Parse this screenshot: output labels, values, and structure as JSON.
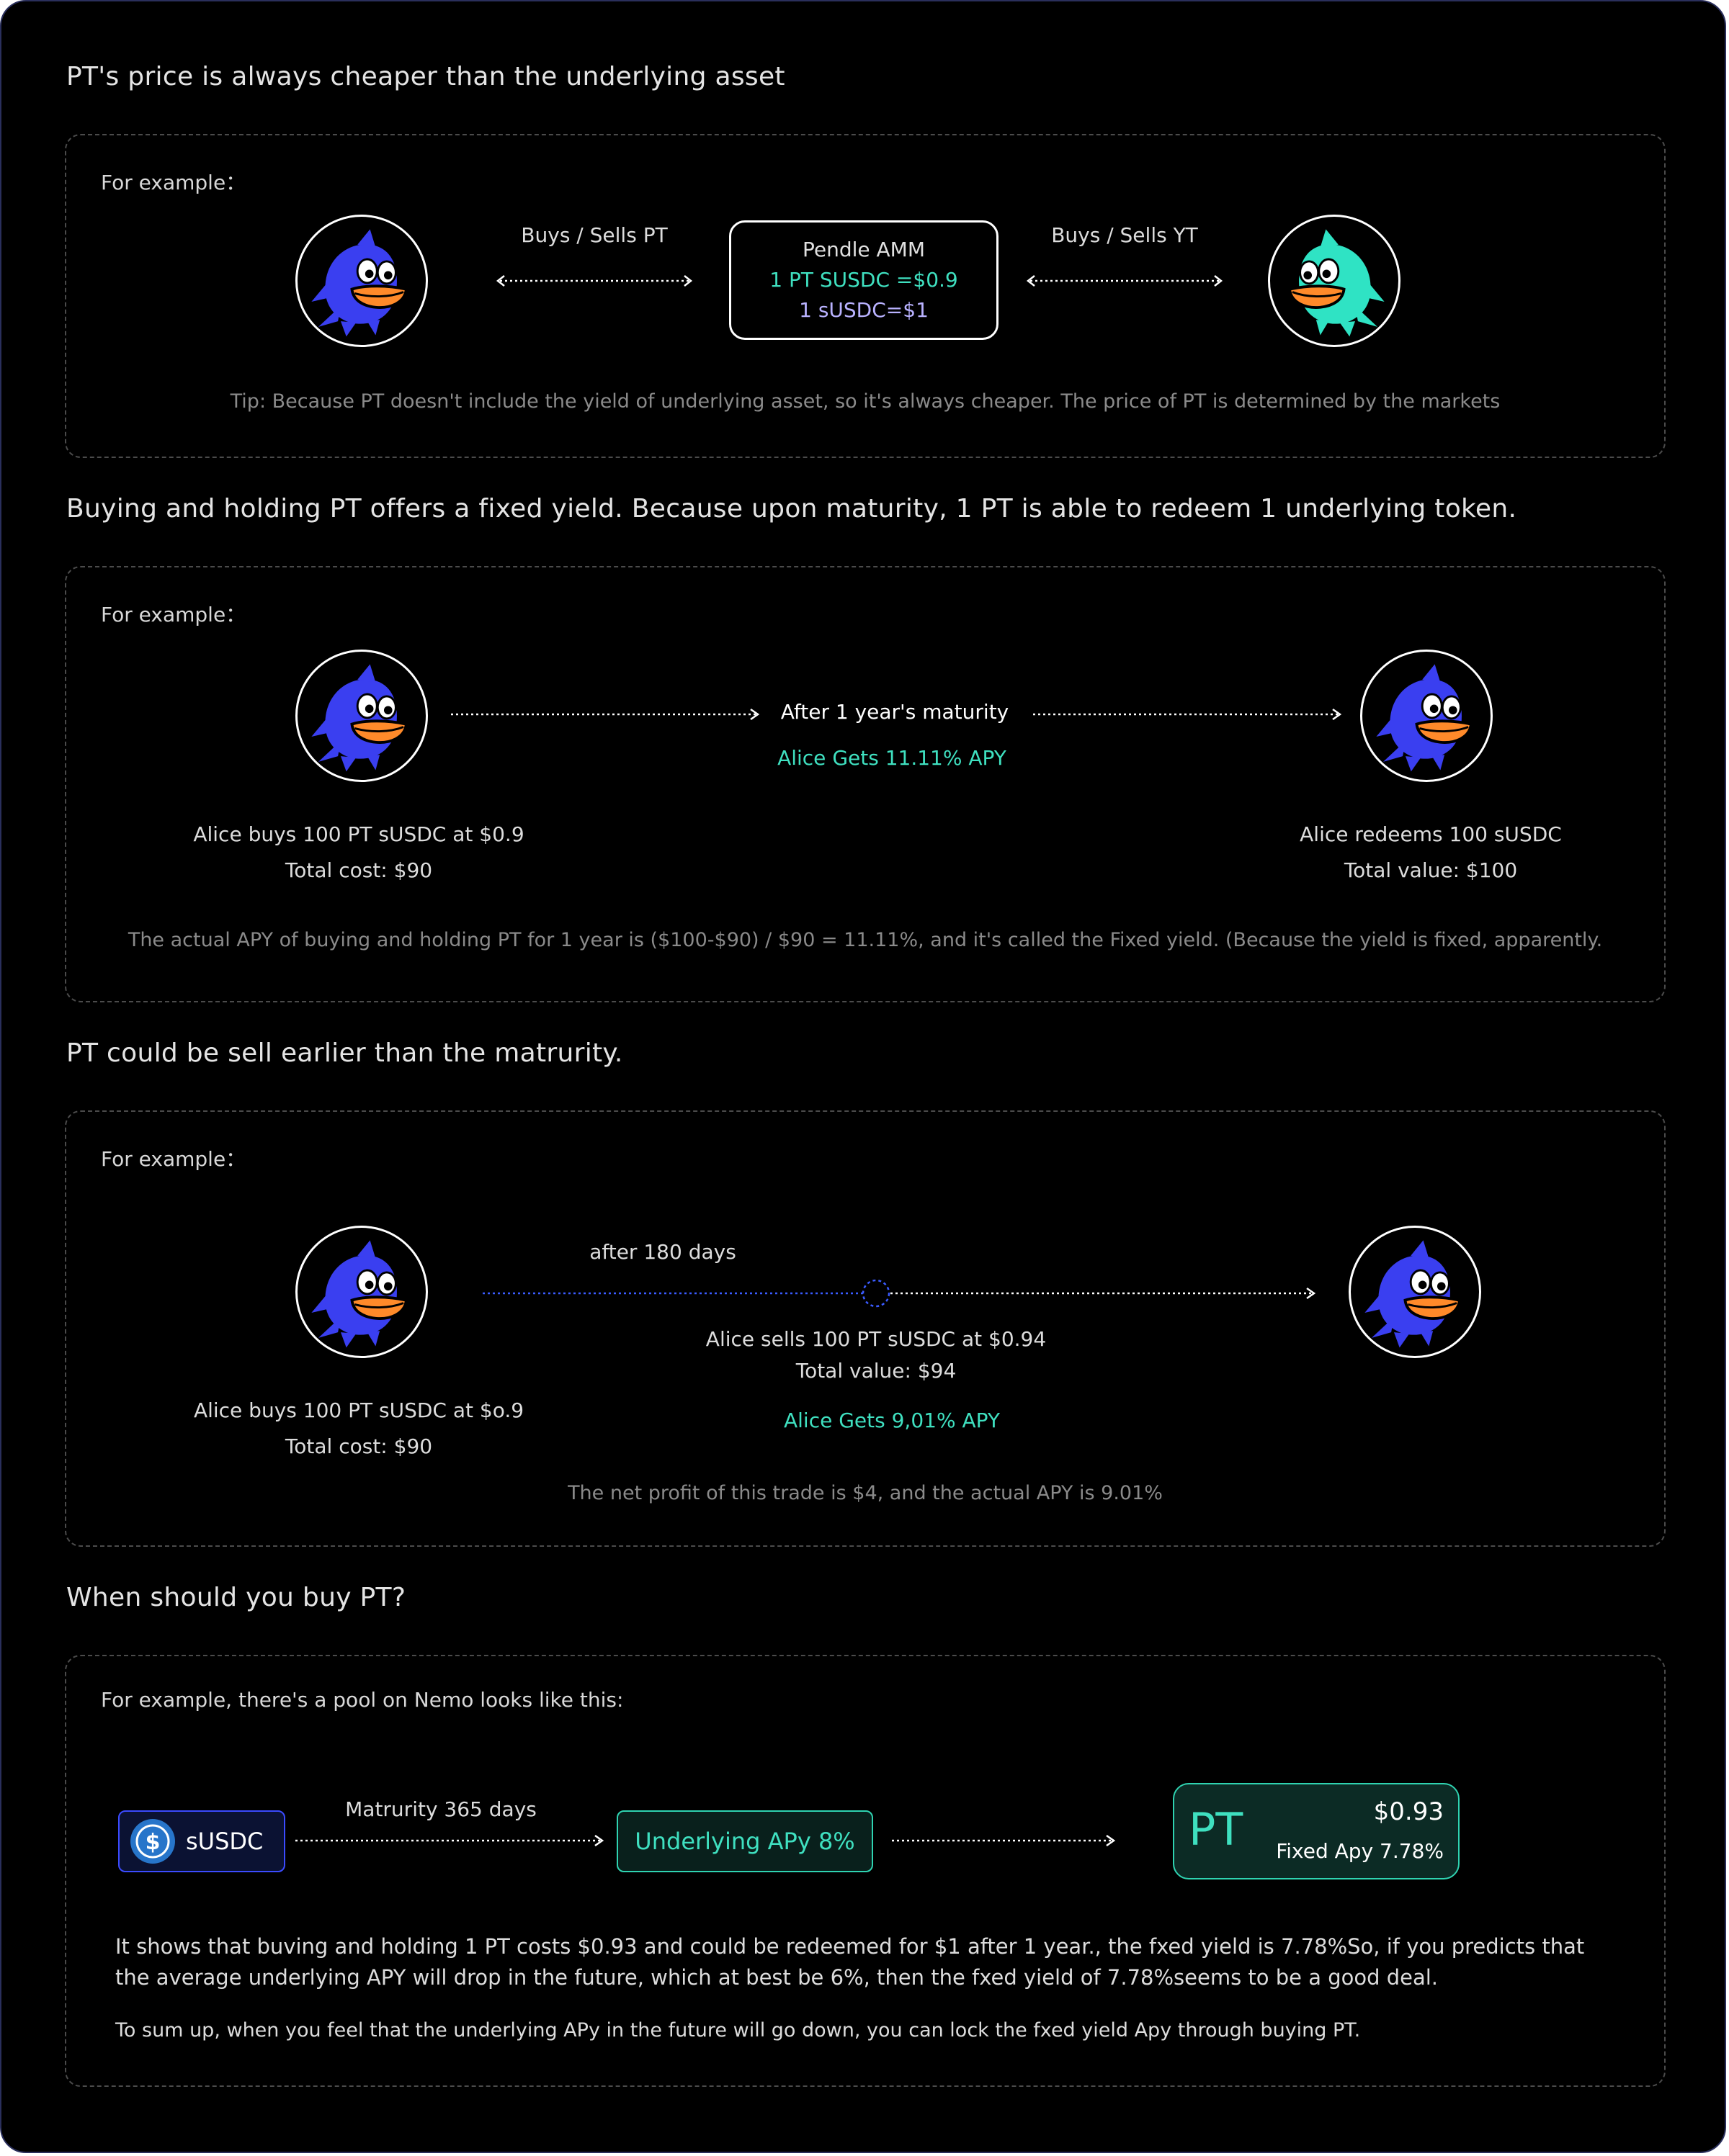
{
  "section1": {
    "heading": "PT's price is always cheaper than the underlying asset",
    "example_label": "For example：",
    "left_arrow_label": "Buys / Sells PT",
    "right_arrow_label": "Buys / Sells YT",
    "amm": {
      "title": "Pendle AMM",
      "pt_price": "1 PT SUSDC =$0.9",
      "susdc_price": "1 sUSDC=$1"
    },
    "tip": "Tip: Because PT doesn't include the yield of underlying asset, so it's always cheaper. The price of PT is determined by the markets"
  },
  "section2": {
    "heading": "Buying and holding PT offers a fixed yield. Because upon maturity, 1 PT is able to redeem 1 underlying token.",
    "example_label": "For example：",
    "arrow_label": "After 1 year's maturity",
    "apy_label": "Alice Gets 11.11% APY",
    "left_caption": [
      "Alice buys 100 PT sUSDC at $0.9",
      "Total cost: $90"
    ],
    "right_caption": [
      "Alice redeems 100 sUSDC",
      "Total value: $100"
    ],
    "note": "The actual APY of buying and holding PT for 1 year is ($100-$90) / $90 = 11.11%, and it's called the Fixed yield. (Because the yield is fixed, apparently."
  },
  "section3": {
    "heading": "PT could be sell earlier than the matrurity.",
    "example_label": "For example：",
    "timeline_label": "after 180 days",
    "sell_caption": [
      "Alice sells 100 PT sUSDC at $0.94",
      "Total value: $94"
    ],
    "apy_label": "Alice Gets 9,01% APY",
    "left_caption": [
      "Alice buys 100 PT sUSDC at $o.9",
      "Total cost: $90"
    ],
    "note": "The net profit of this trade is $4, and the actual APY is 9.01%"
  },
  "section4": {
    "heading": "When should you buy PT?",
    "intro": "For example, there's a pool on Nemo looks like this:",
    "token_name": "sUSDC",
    "maturity_label": "Matrurity 365 days",
    "underlying_apy": "Underlying APy 8%",
    "pt_card": {
      "symbol": "PT",
      "price": "$0.93",
      "fixed_apy": "Fixed Apy 7.78%"
    },
    "paragraph": "It shows that buving and holding 1 PT costs $0.93 and could be redeemed for $1 after 1 year., the fxed yield is 7.78%So, if you predicts that the average underlying APY will drop in the future, which at best be 6%, then the fxed yield of 7.78%seems to be a good deal.",
    "summary": "To sum up, when you feel that the underlying APy in the future will go down, you can lock the fxed yield Apy through buying PT."
  },
  "colors": {
    "background": "#000000",
    "accent_teal": "#3fe0c0",
    "accent_lilac": "#b9b2ff",
    "mascot_blue": "#3a3ff0",
    "mascot_teal": "#2fe3c4",
    "mascot_mouth": "#ff8a2a",
    "usdc_blue": "#2775ca"
  },
  "icons": {
    "mascot": "blue-fish-mascot",
    "mascot_alt": "teal-fish-mascot",
    "token": "usdc-coin-icon"
  }
}
